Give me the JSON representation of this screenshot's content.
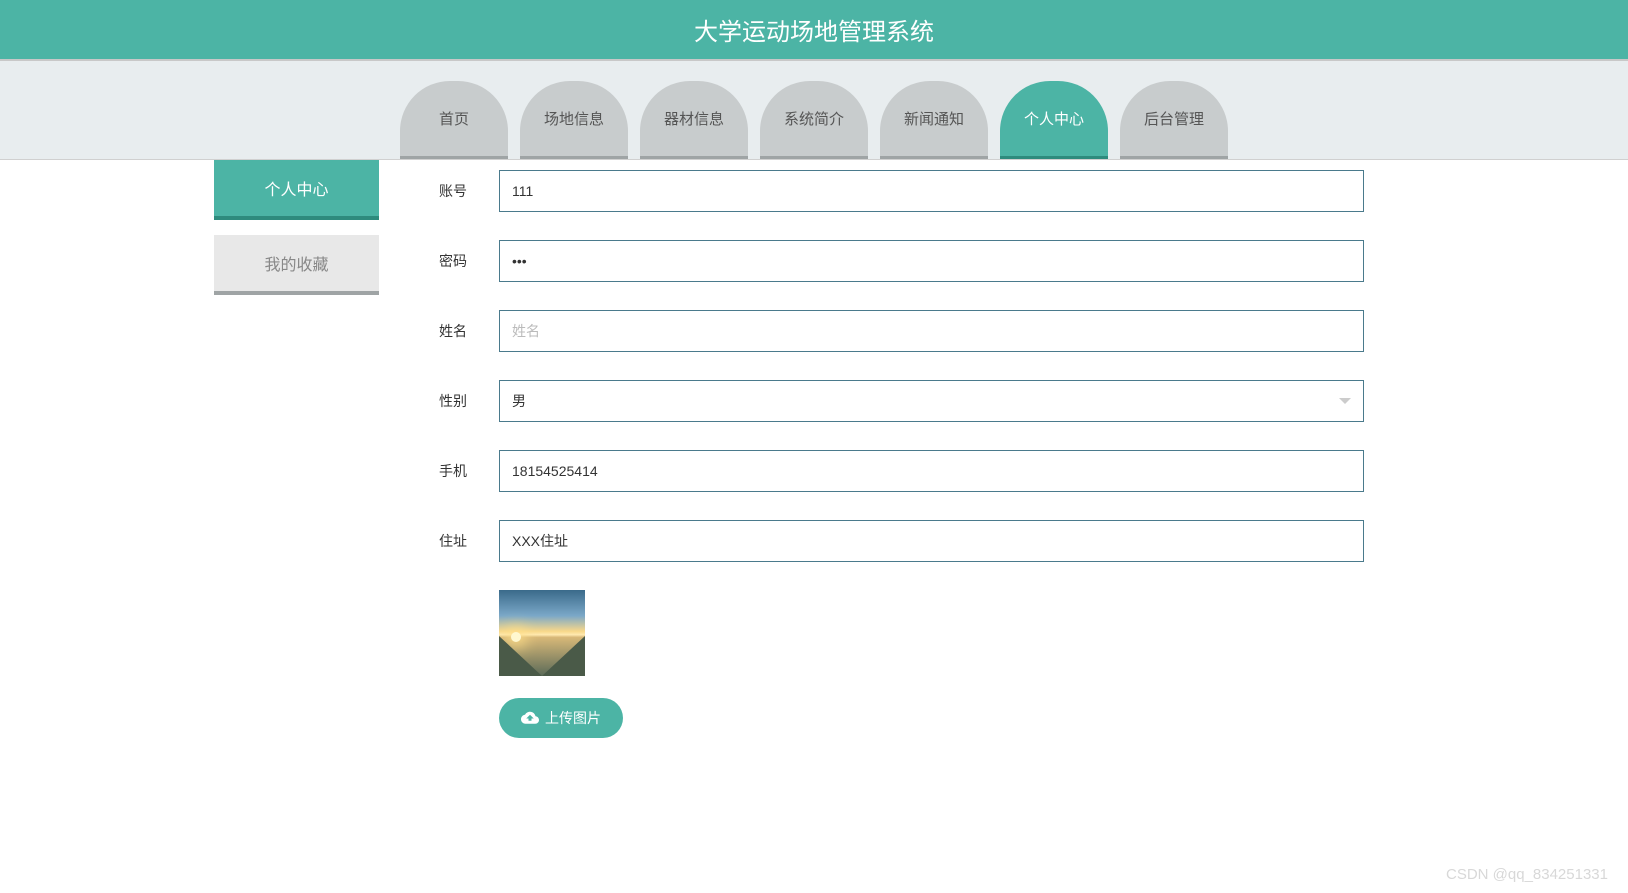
{
  "header": {
    "title": "大学运动场地管理系统"
  },
  "nav": {
    "items": [
      {
        "label": "首页",
        "active": false
      },
      {
        "label": "场地信息",
        "active": false
      },
      {
        "label": "器材信息",
        "active": false
      },
      {
        "label": "系统简介",
        "active": false
      },
      {
        "label": "新闻通知",
        "active": false
      },
      {
        "label": "个人中心",
        "active": true
      },
      {
        "label": "后台管理",
        "active": false
      }
    ]
  },
  "sidebar": {
    "items": [
      {
        "label": "个人中心",
        "active": true
      },
      {
        "label": "我的收藏",
        "active": false
      }
    ]
  },
  "form": {
    "account": {
      "label": "账号",
      "value": "111"
    },
    "password": {
      "label": "密码",
      "value": "•••"
    },
    "name": {
      "label": "姓名",
      "value": "",
      "placeholder": "姓名"
    },
    "gender": {
      "label": "性别",
      "value": "男"
    },
    "phone": {
      "label": "手机",
      "value": "18154525414"
    },
    "address": {
      "label": "住址",
      "value": "XXX住址"
    }
  },
  "upload": {
    "label": "上传图片"
  },
  "watermark": "CSDN @qq_834251331"
}
